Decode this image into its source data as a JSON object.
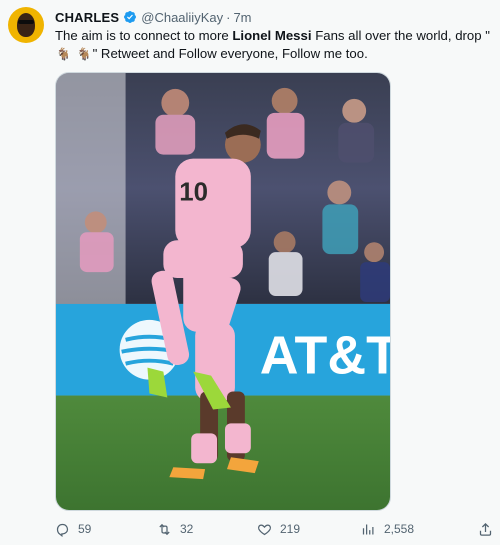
{
  "tweet": {
    "author": {
      "display_name": "CHARLES",
      "handle": "@ChaaliiyKay",
      "separator": "·",
      "time": "7m"
    },
    "text": {
      "part1": "The aim is to connect to more ",
      "bold": "Lionel Messi",
      "part2": " Fans all over the world, drop \"",
      "goat1": "🐐",
      "goat2": "🐐",
      "part3": "\" Retweet and Follow everyone, Follow me too."
    },
    "media": {
      "sponsor_text": "AT&T"
    },
    "actions": {
      "replies": "59",
      "retweets": "32",
      "likes": "219",
      "views": "2,558"
    }
  },
  "colors": {
    "verified": "#1d9bf0",
    "muted": "#536471",
    "jersey_pink": "#f3b6cf",
    "banner_blue": "#27a4dc"
  },
  "icons": [
    "reply-icon",
    "retweet-icon",
    "like-icon",
    "views-icon",
    "share-icon",
    "verified-badge-icon"
  ]
}
